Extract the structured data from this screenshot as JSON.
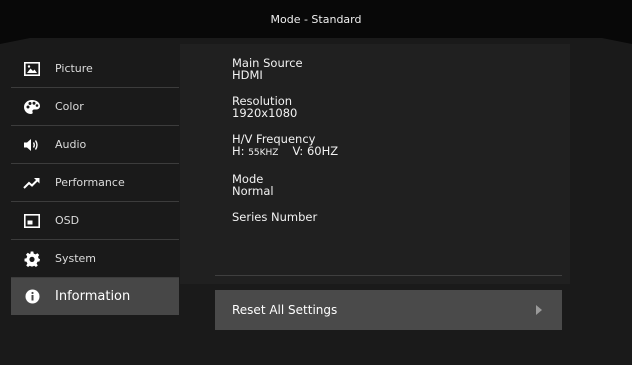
{
  "header": {
    "title": "Mode - Standard"
  },
  "sidebar": {
    "items": [
      {
        "label": "Picture",
        "icon": "picture-icon"
      },
      {
        "label": "Color",
        "icon": "palette-icon"
      },
      {
        "label": "Audio",
        "icon": "speaker-icon"
      },
      {
        "label": "Performance",
        "icon": "trend-arrow-icon"
      },
      {
        "label": "OSD",
        "icon": "osd-window-icon"
      },
      {
        "label": "System",
        "icon": "gear-icon"
      },
      {
        "label": "Information",
        "icon": "info-icon"
      }
    ],
    "active": "Information"
  },
  "info": {
    "main_source_label": "Main Source",
    "main_source_value": "HDMI",
    "resolution_label": "Resolution",
    "resolution_value": "1920x1080",
    "freq_label": "H/V Frequency",
    "freq_h_prefix": "H:",
    "freq_h_value": "55KHZ",
    "freq_v_prefix": "V:",
    "freq_v_value": "60HZ",
    "mode_label": "Mode",
    "mode_value": "Normal",
    "series_label": "Series Number"
  },
  "reset": {
    "label": "Reset All Settings"
  }
}
